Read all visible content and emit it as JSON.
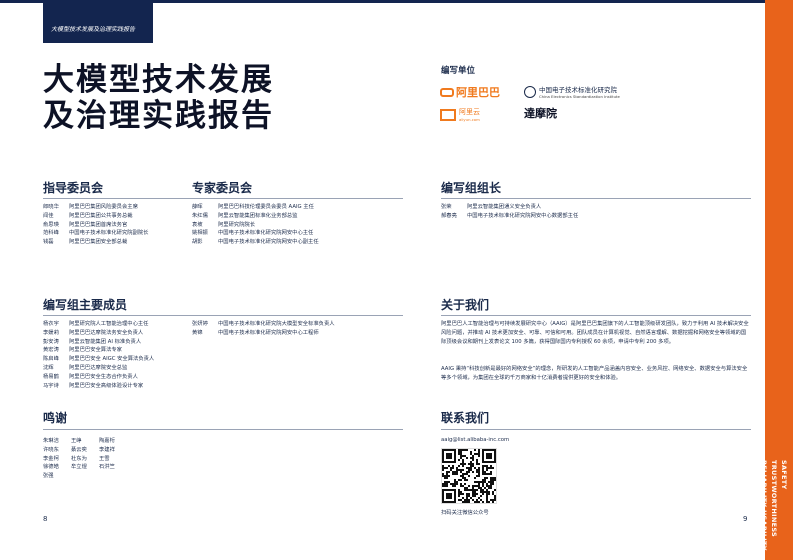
{
  "header": {
    "tag": "大模型技术发展及治理实践报告"
  },
  "title": {
    "line1": "大模型技术发展",
    "line2": "及治理实践报告"
  },
  "compile_units": {
    "label": "编写单位",
    "alibaba": "阿里巴巴",
    "cesi": "中国电子技术标准化研究院",
    "cesi_en": "China Electronics Standardization Institute",
    "aliyun": "阿里云",
    "aliyun_en": "aliyun.com",
    "damo": "達摩院"
  },
  "sidebar": {
    "line1": "SAFETY TRUSTWORTHINESS",
    "line2": "RELIABILITY USABILITY"
  },
  "guidance": {
    "heading": "指导委员会",
    "rows": [
      {
        "name": "郎晓华",
        "role": "阿里巴巴集团风险委员会主席"
      },
      {
        "name": "闻佳",
        "role": "阿里巴巴集团公共事务总裁"
      },
      {
        "name": "俞思瑛",
        "role": "阿里巴巴集团首席法务官"
      },
      {
        "name": "范科峰",
        "role": "中国电子技术标准化研究院副院长"
      },
      {
        "name": "钱磊",
        "role": "阿里巴巴集团安全部总裁"
      }
    ]
  },
  "experts": {
    "heading": "专家委员会",
    "rows": [
      {
        "name": "薛晖",
        "role": "阿里巴巴科技伦理委员会委员 AAIG 主任"
      },
      {
        "name": "朱红儒",
        "role": "阿里云智能集团标准化业务部总监"
      },
      {
        "name": "袁坡",
        "role": "阿里研究院院长"
      },
      {
        "name": "姚相振",
        "role": "中国电子技术标准化研究院网安中心主任"
      },
      {
        "name": "胡影",
        "role": "中国电子技术标准化研究院网安中心副主任"
      }
    ]
  },
  "lead": {
    "heading": "编写组组长",
    "rows": [
      {
        "name": "张荣",
        "role": "阿里云智能集团通义安全负责人"
      },
      {
        "name": "郝春亮",
        "role": "中国电子技术标准化研究院网安中心数据部主任"
      }
    ]
  },
  "members": {
    "heading": "编写组主要成员",
    "col1": [
      {
        "name": "杨衣宇",
        "role": "阿里研究院人工智能治理中心主任"
      },
      {
        "name": "李媛莉",
        "role": "阿里巴巴达摩院法务安全负责人"
      },
      {
        "name": "彭安涛",
        "role": "阿里云智能集团 AI 标准负责人"
      },
      {
        "name": "黄宏涛",
        "role": "阿里巴巴安全算法专家"
      },
      {
        "name": "陈启峰",
        "role": "阿里巴巴安全 AIGC 安全算法负责人"
      },
      {
        "name": "沈辉",
        "role": "阿里巴巴达摩院安全总监"
      },
      {
        "name": "杨易鹤",
        "role": "阿里巴巴安全生态合作负责人"
      },
      {
        "name": "马宇诗",
        "role": "阿里巴巴安全高级体验设计专家"
      }
    ],
    "col2": [
      {
        "name": "张妍婷",
        "role": "中国电子技术标准化研究院大模型安全标准负责人"
      },
      {
        "name": "黄锦",
        "role": "中国电子技术标准化研究院网安中心工程师"
      }
    ]
  },
  "about": {
    "heading": "关于我们",
    "p1": "阿里巴巴人工智能治理与可持续发展研究中心（AAIG）是阿里巴巴集团旗下的人工智能顶级研发团队，致力于利用 AI 技术解决安全风险问题，并推动 AI 技术更加安全、可靠、可信和可用。团队成员在计算机视觉、自然语言理解、数据挖掘和网络安全等领域的国际顶级会议和期刊上发表论文 100 多篇，获得国际国内专利授权 60 余项，申请中专利 200 多项。",
    "p2": "AAIG 秉持“科技创新是最好的网络安全”的理念，所研发的人工智能产品涵盖内容安全、业务风控、网络安全、数据安全与算法安全等多个领域，为集团在全球的千万商家和十亿消费者提供更好的安全和体验。"
  },
  "thanks": {
    "heading": "鸣谢",
    "names": [
      "朱琳洁",
      "王峥",
      "陶嘉桁",
      "许晓东",
      "綦云奕",
      "李建祥",
      "李金柯",
      "杜东为",
      "王雪",
      "徐德皓",
      "牟立煜",
      "石洪竺",
      "张强",
      "",
      ""
    ]
  },
  "contact": {
    "heading": "联系我们",
    "email": "aaig@list.alibaba-inc.com",
    "qr_caption": "扫码关注微信公众号"
  },
  "pages": {
    "left": "8",
    "right": "9"
  },
  "colors": {
    "navy": "#13254f",
    "orange": "#e8631b",
    "text": "#1a2a4a"
  }
}
